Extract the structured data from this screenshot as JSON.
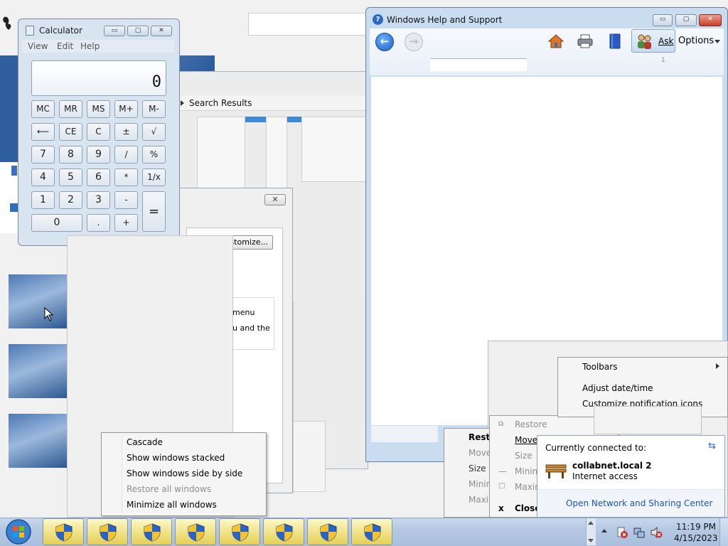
{
  "calculator": {
    "title": "Calculator",
    "menu": [
      "View",
      "Edit",
      "Help"
    ],
    "display": "0",
    "window_buttons": [
      "▭",
      "▢",
      "✕"
    ],
    "buttons": {
      "row1": [
        "MC",
        "MR",
        "MS",
        "M+",
        "M-"
      ],
      "row2": [
        "⟵",
        "CE",
        "C",
        "±",
        "√"
      ],
      "row3": [
        "7",
        "8",
        "9",
        "/",
        "%"
      ],
      "row4": [
        "4",
        "5",
        "6",
        "*",
        "1/x"
      ],
      "row5": [
        "1",
        "2",
        "3",
        "-"
      ],
      "row6": [
        "0",
        ".",
        "+"
      ],
      "equals": "="
    }
  },
  "search_results": {
    "label": "Search Results"
  },
  "dialog": {
    "customize": "stomize...",
    "text1": "menu",
    "text2": "u and the",
    "close": "✕"
  },
  "help_window": {
    "title": "Windows Help and Support",
    "ask": "Ask",
    "options": "Options",
    "search_sub": "1",
    "window_buttons": [
      "▭",
      "▢",
      "✕"
    ]
  },
  "desktop_context_menu": {
    "items": [
      {
        "label": "Cascade",
        "disabled": false
      },
      {
        "label": "Show windows stacked",
        "disabled": false
      },
      {
        "label": "Show windows side by side",
        "disabled": false
      },
      {
        "label": "Restore all windows",
        "disabled": true
      },
      {
        "label": "Minimize all windows",
        "disabled": false
      }
    ]
  },
  "window_menu_back": {
    "items": [
      "Resto",
      "Move",
      "Size",
      "Minim",
      "Maxim"
    ]
  },
  "window_menu": {
    "items": [
      {
        "label": "Restore",
        "disabled": true
      },
      {
        "label": "Move",
        "disabled": false
      },
      {
        "label": "Size",
        "disabled": true
      },
      {
        "label": "Minim",
        "disabled": true
      },
      {
        "label": "Maxim",
        "disabled": true
      },
      {
        "label": "Close",
        "disabled": false
      }
    ],
    "close_glyph": "x"
  },
  "tray_menu": {
    "items": [
      "Toolbars",
      "Adjust date/time",
      "Customize notification icons"
    ]
  },
  "network_popup": {
    "header": "Currently connected to:",
    "network_name": "collabnet.local  2",
    "status": "Internet access",
    "link": "Open Network and Sharing Center"
  },
  "taskbar": {
    "time": "11:19 PM",
    "date": "4/15/2023",
    "app_count": 8
  }
}
